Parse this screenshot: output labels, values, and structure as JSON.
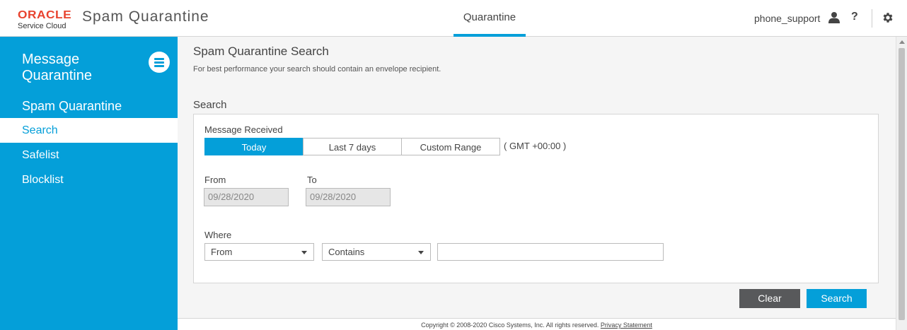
{
  "header": {
    "logo_brand": "ORACLE",
    "logo_sub": "Service Cloud",
    "app_title": "Spam Quarantine",
    "nav_tab": "Quarantine",
    "username": "phone_support",
    "help_glyph": "?"
  },
  "sidebar": {
    "title_line1": "Message",
    "title_line2": "Quarantine",
    "section": "Spam Quarantine",
    "items": [
      {
        "label": "Search",
        "active": true
      },
      {
        "label": "Safelist",
        "active": false
      },
      {
        "label": "Blocklist",
        "active": false
      }
    ]
  },
  "main": {
    "title": "Spam Quarantine Search",
    "hint": "For best performance your search should contain an envelope recipient.",
    "section_label": "Search",
    "message_received_label": "Message Received",
    "range_options": [
      "Today",
      "Last 7 days",
      "Custom Range"
    ],
    "selected_range": "Today",
    "timezone": "( GMT +00:00 )",
    "from_label": "From",
    "to_label": "To",
    "from_date": "09/28/2020",
    "to_date": "09/28/2020",
    "where_label": "Where",
    "where_field": "From",
    "where_operator": "Contains",
    "where_value": "",
    "clear_label": "Clear",
    "search_label": "Search"
  },
  "footer": {
    "copyright": "Copyright © 2008-2020 Cisco Systems, Inc. All rights reserved.",
    "privacy_link": "Privacy Statement"
  },
  "colors": {
    "accent": "#049fd9",
    "brand_red": "#e8432f",
    "button_dark": "#58595b"
  }
}
